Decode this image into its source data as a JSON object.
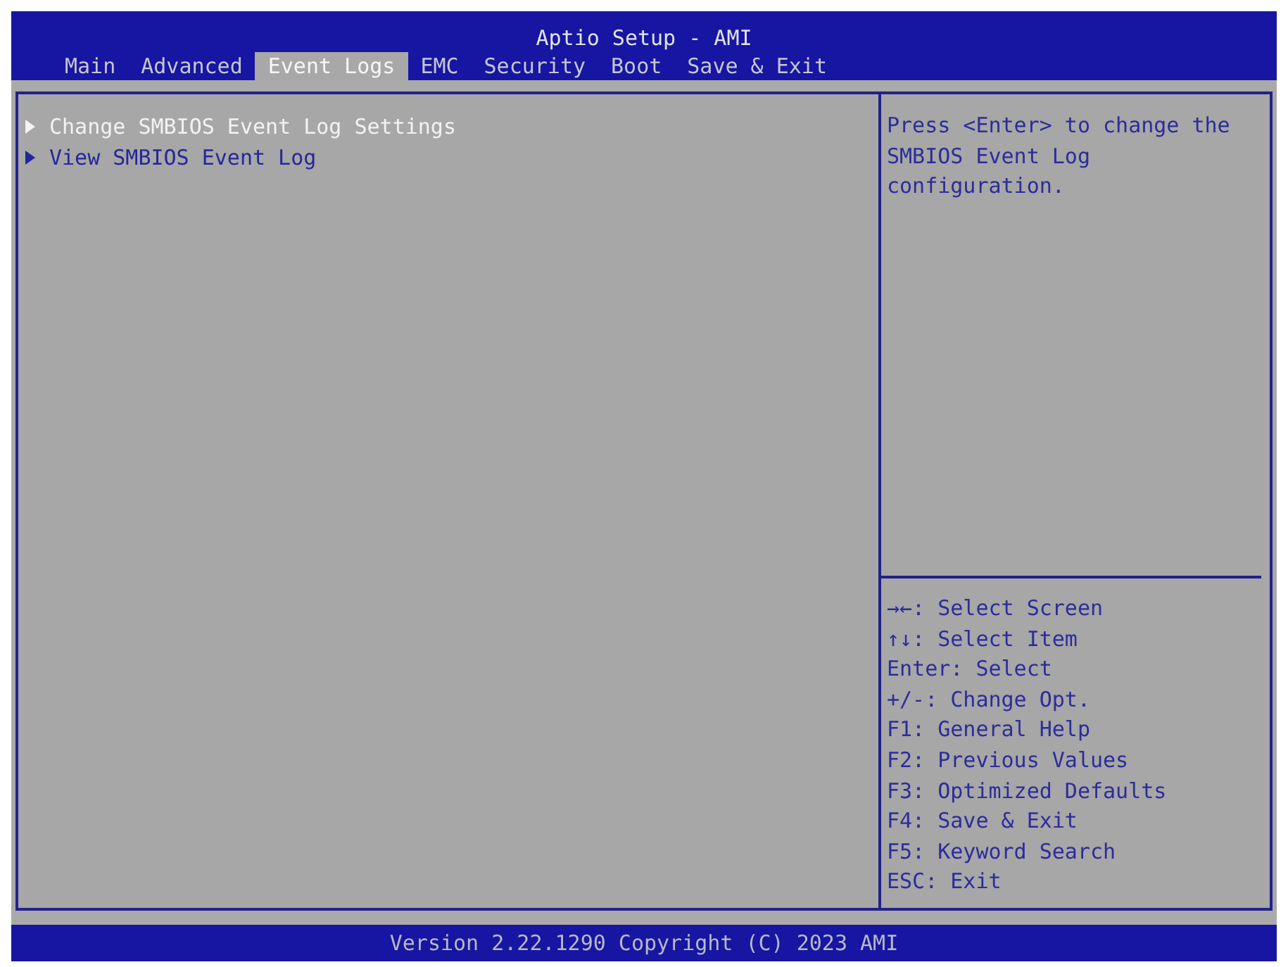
{
  "window": {
    "title": "Aptio Setup - AMI"
  },
  "tabs": [
    {
      "label": "Main",
      "selected": false
    },
    {
      "label": "Advanced",
      "selected": false
    },
    {
      "label": "Event Logs",
      "selected": true
    },
    {
      "label": "EMC",
      "selected": false
    },
    {
      "label": "Security",
      "selected": false
    },
    {
      "label": "Boot",
      "selected": false
    },
    {
      "label": "Save & Exit",
      "selected": false
    }
  ],
  "menu": {
    "items": [
      {
        "label": "Change SMBIOS Event Log Settings",
        "selected": true
      },
      {
        "label": "View SMBIOS Event Log",
        "selected": false
      }
    ]
  },
  "help": {
    "text": "Press <Enter> to change the SMBIOS Event Log configuration.",
    "keys": [
      "→←: Select Screen",
      "↑↓: Select Item",
      "Enter: Select",
      "+/-: Change Opt.",
      "F1: General Help",
      "F2: Previous Values",
      "F3: Optimized Defaults",
      "F4: Save & Exit",
      "F5: Keyword Search",
      "ESC: Exit"
    ]
  },
  "status_bar": {
    "text": "Version 2.22.1290 Copyright (C) 2023 AMI"
  }
}
